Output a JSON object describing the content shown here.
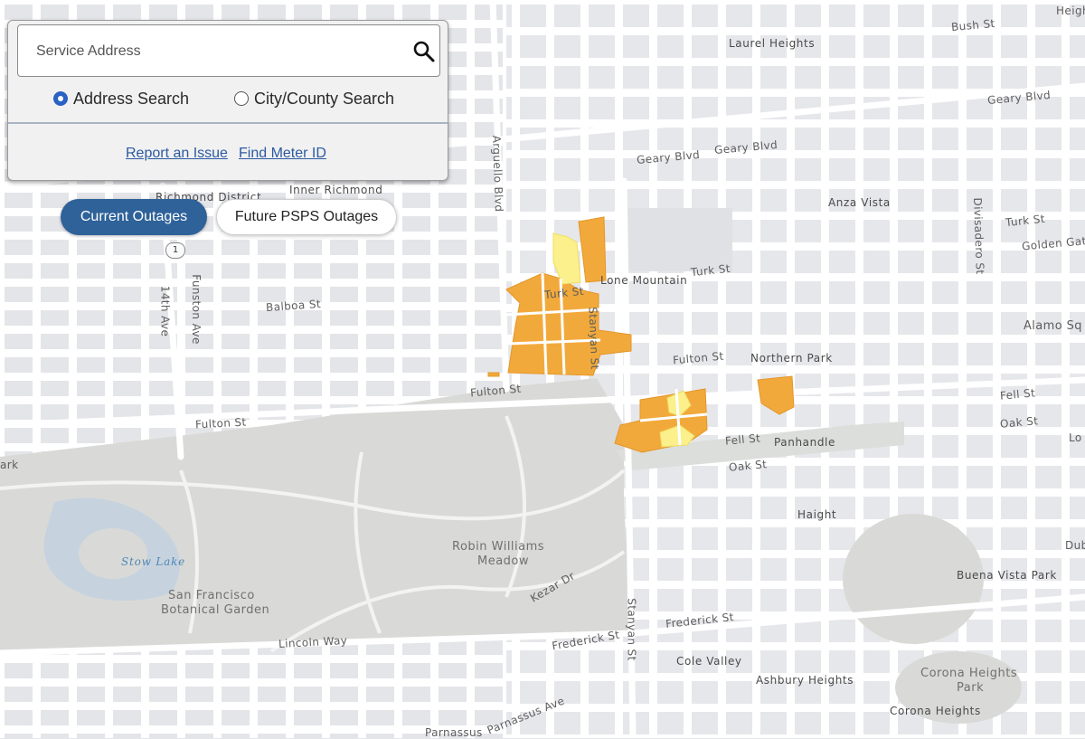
{
  "search": {
    "placeholder": "Service Address",
    "modes": [
      {
        "label": "Address Search",
        "selected": true
      },
      {
        "label": "City/County Search",
        "selected": false
      }
    ],
    "icon": "search-icon"
  },
  "links": {
    "report": "Report an Issue",
    "meter": "Find Meter ID"
  },
  "tabs": {
    "current": "Current Outages",
    "future": "Future PSPS Outages",
    "active": "current"
  },
  "colors": {
    "accent": "#2e6299",
    "radio_selected": "#2a62c4",
    "link": "#2c5aa0",
    "outage_orange": "#f2a93b",
    "outage_yellow": "#fbf08c",
    "park": "#d9dad7",
    "water": "#c6d3df",
    "road": "#ffffff"
  },
  "map": {
    "highway_shield": "1",
    "street_labels": [
      "Laurel Heights",
      "Bush St",
      "Geary Blvd",
      "Geary Blvd",
      "Geary Blvd",
      "Richmond District",
      "Inner Richmond",
      "Arguello Blvd",
      "Anza Vista",
      "Turk St",
      "Golden Gate",
      "Divisadero St",
      "Lone Mountain",
      "Turk St",
      "Turk St",
      "Stanyan St",
      "14th Ave",
      "Funston Ave",
      "Balboa St",
      "Alamo Sq",
      "Fulton St",
      "Northern Park",
      "Fulton St",
      "Fulton St",
      "Fell St",
      "Oak St",
      "Fell St",
      "Panhandle",
      "Oak St",
      "Haight",
      "Robin Williams",
      "Meadow",
      "Kezar Dr",
      "Stow Lake",
      "San Francisco",
      "Botanical Garden",
      "Buena Vista Park",
      "Frederick St",
      "Frederick St",
      "Stanyan St",
      "Lincoln Way",
      "Cole Valley",
      "Ashbury Heights",
      "Corona Heights",
      "Park",
      "Corona Heights",
      "Parnassus Ave",
      "Parnassus",
      "Heigh",
      "Lo",
      "Dub",
      "ark"
    ]
  }
}
